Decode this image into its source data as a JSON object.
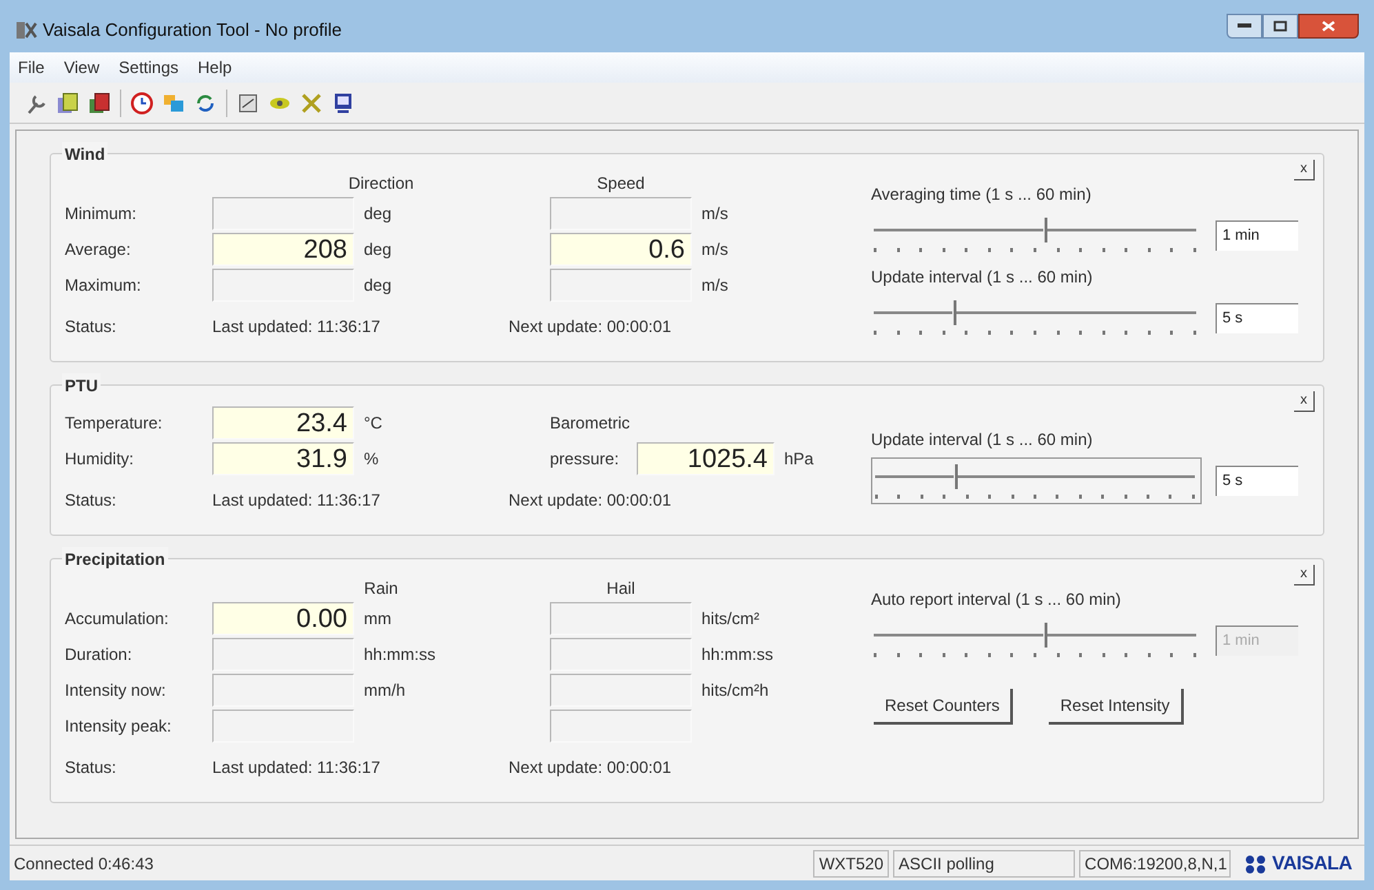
{
  "window": {
    "title": "Vaisala Configuration Tool - No profile"
  },
  "menu": [
    "File",
    "View",
    "Settings",
    "Help"
  ],
  "panels": [
    {
      "title": "Wind",
      "close_label": "x",
      "columns": [
        "Direction",
        "Speed"
      ],
      "rows": [
        {
          "label": "Minimum:",
          "fields": [
            {
              "kind": "field",
              "unit": "deg",
              "highlighted": false
            },
            {
              "kind": "field",
              "unit": "m/s",
              "highlighted": false
            }
          ]
        },
        {
          "label": "Average:",
          "fields": [
            {
              "kind": "field",
              "value": "208",
              "unit": "deg",
              "highlighted": true
            },
            {
              "kind": "field",
              "value": "0.6",
              "unit": "m/s",
              "highlighted": true
            }
          ]
        },
        {
          "label": "Maximum:",
          "fields": [
            {
              "kind": "field",
              "unit": "deg",
              "highlighted": false
            },
            {
              "kind": "field",
              "unit": "m/s",
              "highlighted": false
            }
          ]
        }
      ],
      "status": {
        "label": "Status:",
        "last_updated": "Last updated: 11:36:17",
        "next_update": "Next update: 00:00:01"
      },
      "sliders": [
        {
          "label": "Averaging time (1 s ... 60 min)",
          "level": 0.54,
          "value": "1 min",
          "disabled": false,
          "focused": false
        },
        {
          "label": "Update interval (1 s ... 60 min)",
          "level": 0.25,
          "value": "5 s",
          "disabled": false,
          "focused": false
        }
      ]
    },
    {
      "title": "PTU",
      "close_label": "x",
      "rows": [
        {
          "label": "Temperature:",
          "fields": [
            {
              "kind": "field",
              "value": "23.4",
              "unit": "°C",
              "highlighted": true
            },
            {
              "kind": "text",
              "label": "Barometric"
            }
          ]
        },
        {
          "label": "Humidity:",
          "fields": [
            {
              "kind": "field",
              "value": "31.9",
              "unit": "%",
              "highlighted": true
            },
            {
              "kind": "field",
              "label": "pressure:",
              "value": "1025.4",
              "unit": "hPa",
              "highlighted": true
            }
          ]
        }
      ],
      "status": {
        "label": "Status:",
        "last_updated": "Last updated: 11:36:17",
        "next_update": "Next update: 00:00:01"
      },
      "sliders": [
        {
          "label": "Update interval (1 s ... 60 min)",
          "level": 0.25,
          "value": "5 s",
          "disabled": false,
          "focused": true
        }
      ]
    },
    {
      "title": "Precipitation",
      "close_label": "x",
      "columns": [
        "Rain",
        "Hail"
      ],
      "rows": [
        {
          "label": "Accumulation:",
          "fields": [
            {
              "kind": "field",
              "value": "0.00",
              "unit": "mm",
              "highlighted": true
            },
            {
              "kind": "field",
              "unit": "hits/cm²",
              "highlighted": false
            }
          ]
        },
        {
          "label": "Duration:",
          "fields": [
            {
              "kind": "field",
              "unit": "hh:mm:ss",
              "highlighted": false
            },
            {
              "kind": "field",
              "unit": "hh:mm:ss",
              "highlighted": false
            }
          ]
        },
        {
          "label": "Intensity now:",
          "fields": [
            {
              "kind": "field",
              "unit": "mm/h",
              "highlighted": false
            },
            {
              "kind": "field",
              "unit": "hits/cm²h",
              "highlighted": false
            }
          ]
        },
        {
          "label": "Intensity peak:",
          "fields": [
            {
              "kind": "field",
              "highlighted": false
            },
            {
              "kind": "field",
              "highlighted": false
            }
          ]
        }
      ],
      "status": {
        "label": "Status:",
        "last_updated": "Last updated: 11:36:17",
        "next_update": "Next update: 00:00:01"
      },
      "sliders": [
        {
          "label": "Auto report interval (1 s ... 60 min)",
          "level": 0.54,
          "value": "1 min",
          "disabled": true,
          "focused": false
        }
      ],
      "buttons": [
        "Reset Counters",
        "Reset Intensity"
      ]
    }
  ],
  "status_bar": {
    "connection": "Connected 0:46:43",
    "device": "WXT520",
    "protocol": "ASCII polling",
    "port": "COM6:19200,8,N,1",
    "logo": "VAISALA"
  }
}
